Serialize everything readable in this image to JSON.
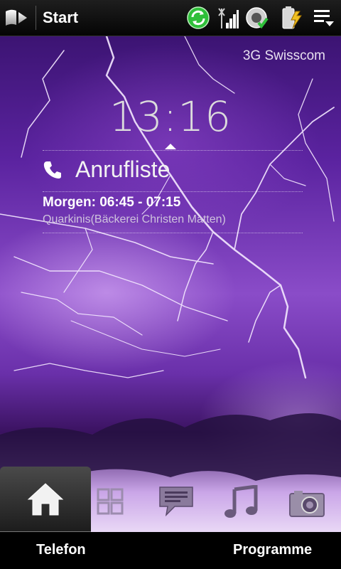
{
  "status_bar": {
    "start_label": "Start",
    "icons": [
      "windows-start-icon",
      "sync-icon",
      "signal-strength-icon",
      "wifi-icon",
      "battery-charging-icon",
      "menu-icon"
    ]
  },
  "home": {
    "operator": "3G Swisscom",
    "clock": "13:16",
    "calls_label": "Anrufliste",
    "appointment": {
      "time": "Morgen: 06:45 - 07:15",
      "subject": "Quarkinis(Bäckerei Christen Matten)"
    }
  },
  "tabs": [
    {
      "icon": "home-icon",
      "active": true
    },
    {
      "icon": "people-icon",
      "active": false
    },
    {
      "icon": "messaging-icon",
      "active": false
    },
    {
      "icon": "music-icon",
      "active": false
    },
    {
      "icon": "camera-icon",
      "active": false
    }
  ],
  "softkeys": {
    "left": "Telefon",
    "right": "Programme"
  },
  "colors": {
    "wallpaper_primary": "#5b23a0",
    "sync_green": "#2fbf3a",
    "accent_yellow": "#f0c020"
  }
}
